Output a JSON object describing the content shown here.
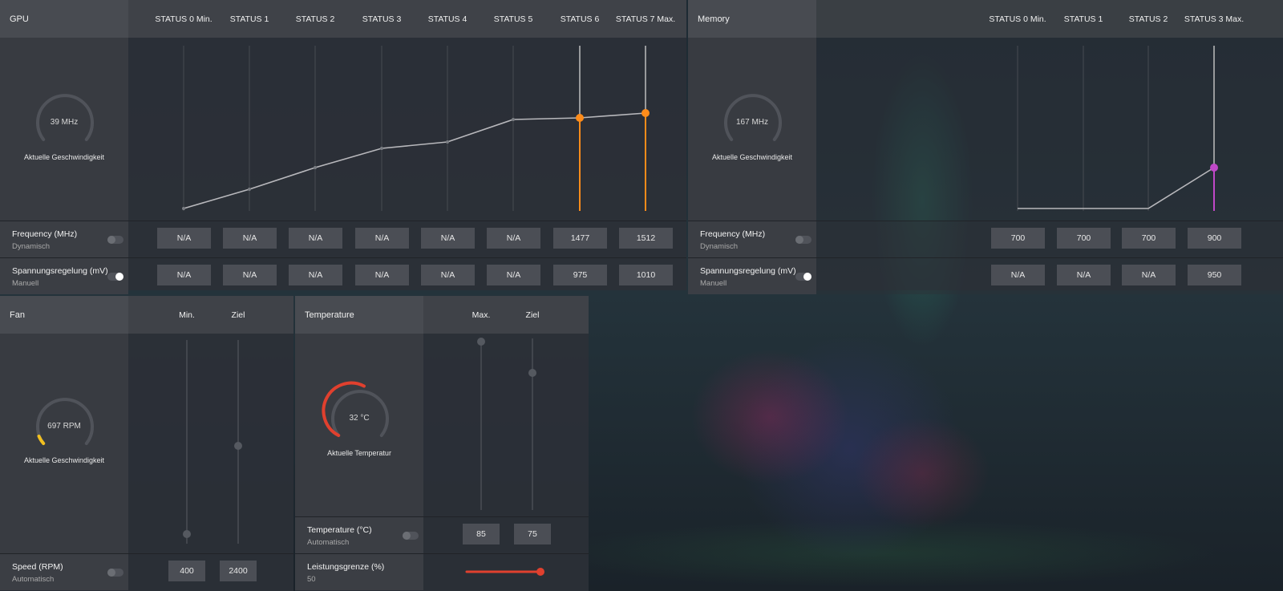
{
  "gpu": {
    "title": "GPU",
    "states": [
      "STATUS 0 Min.",
      "STATUS 1",
      "STATUS 2",
      "STATUS 3",
      "STATUS 4",
      "STATUS 5",
      "STATUS 6",
      "STATUS 7 Max."
    ],
    "gauge_value": "39 MHz",
    "gauge_label": "Aktuelle Geschwindigkeit",
    "frequency": {
      "label": "Frequency (MHz)",
      "mode": "Dynamisch",
      "toggle": "off",
      "values": [
        "N/A",
        "N/A",
        "N/A",
        "N/A",
        "N/A",
        "N/A",
        "1477",
        "1512"
      ]
    },
    "voltage": {
      "label": "Spannungsregelung (mV)",
      "mode": "Manuell",
      "toggle": "on",
      "values": [
        "N/A",
        "N/A",
        "N/A",
        "N/A",
        "N/A",
        "N/A",
        "975",
        "1010"
      ]
    },
    "curve_color": "#b8b8bc",
    "active_color": "#ff8c1a"
  },
  "memory": {
    "title": "Memory",
    "states": [
      "STATUS 0 Min.",
      "STATUS 1",
      "STATUS 2",
      "STATUS 3 Max."
    ],
    "gauge_value": "167 MHz",
    "gauge_label": "Aktuelle Geschwindigkeit",
    "frequency": {
      "label": "Frequency (MHz)",
      "mode": "Dynamisch",
      "toggle": "off",
      "values": [
        "700",
        "700",
        "700",
        "900"
      ]
    },
    "voltage": {
      "label": "Spannungsregelung (mV)",
      "mode": "Manuell",
      "toggle": "on",
      "values": [
        "N/A",
        "N/A",
        "N/A",
        "950"
      ]
    },
    "active_color": "#c048c8"
  },
  "fan": {
    "title": "Fan",
    "columns": [
      "Min.",
      "Ziel"
    ],
    "gauge_value": "697 RPM",
    "gauge_label": "Aktuelle Geschwindigkeit",
    "gauge_color": "#f2c020",
    "speed": {
      "label": "Speed (RPM)",
      "mode": "Automatisch",
      "toggle": "off",
      "values": [
        "400",
        "2400"
      ]
    }
  },
  "temperature": {
    "title": "Temperature",
    "columns": [
      "Max.",
      "Ziel"
    ],
    "gauge_value": "32 °C",
    "gauge_label": "Aktuelle Temperatur",
    "gauge_color": "#e0402e",
    "temp_row": {
      "label": "Temperature (°C)",
      "mode": "Automatisch",
      "toggle": "off",
      "values": [
        "85",
        "75"
      ]
    },
    "power_row": {
      "label": "Leistungsgrenze (%)",
      "value": "50",
      "slider_color": "#e0402e"
    }
  }
}
